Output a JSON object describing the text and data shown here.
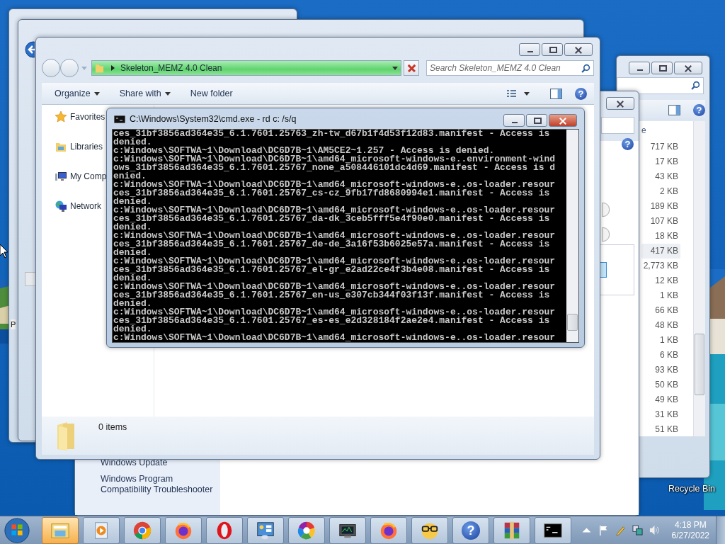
{
  "desktop": {
    "recycle_bin": "Recycle Bin"
  },
  "back_window": {
    "button_label": "P"
  },
  "control_panel_window": {
    "help_glyph": "?",
    "links": [
      "Windows Update",
      "Windows Program Compatibility Troubleshooter"
    ]
  },
  "size_window": {
    "help_glyph": "?",
    "column_header": "e",
    "rows": [
      {
        "size": "717 KB",
        "selected": false
      },
      {
        "size": "17 KB",
        "selected": false
      },
      {
        "size": "43 KB",
        "selected": false
      },
      {
        "size": "2 KB",
        "selected": false
      },
      {
        "size": "189 KB",
        "selected": false
      },
      {
        "size": "107 KB",
        "selected": false
      },
      {
        "size": "18 KB",
        "selected": false
      },
      {
        "size": "417 KB",
        "selected": true
      },
      {
        "size": "2,773 KB",
        "selected": false
      },
      {
        "size": "12 KB",
        "selected": false
      },
      {
        "size": "1 KB",
        "selected": false
      },
      {
        "size": "66 KB",
        "selected": false
      },
      {
        "size": "48 KB",
        "selected": false
      },
      {
        "size": "1 KB",
        "selected": false
      },
      {
        "size": "6 KB",
        "selected": false
      },
      {
        "size": "93 KB",
        "selected": false
      },
      {
        "size": "50 KB",
        "selected": false
      },
      {
        "size": "49 KB",
        "selected": false
      },
      {
        "size": "31 KB",
        "selected": false
      },
      {
        "size": "51 KB",
        "selected": false
      }
    ]
  },
  "explorer": {
    "address": {
      "path": "Skeleton_MEMZ 4.0 Clean",
      "level": 1
    },
    "search": {
      "placeholder": "Search Skeleton_MEMZ 4.0 Clean"
    },
    "help_glyph": "?",
    "toolbar": [
      {
        "label": "Organize",
        "dropdown": true
      },
      {
        "label": "Share with",
        "dropdown": true
      },
      {
        "label": "New folder",
        "dropdown": false
      }
    ],
    "nav": [
      {
        "label": "Favorites",
        "kind": "favorites"
      },
      {
        "label": "Libraries",
        "kind": "libraries"
      },
      {
        "label": "My Comp",
        "kind": "computer"
      },
      {
        "label": "Network",
        "kind": "network"
      }
    ],
    "status": "0 items"
  },
  "console": {
    "title": "C:\\Windows\\System32\\cmd.exe - rd  c: /s/q",
    "lines": [
      "ces_31bf3856ad364e35_6.1.7601.25763_zh-tw_d67b1f4d53f12d83.manifest - Access is",
      "denied.",
      "c:Windows\\SOFTWA~1\\Download\\DC6D7B~1\\AM5CE2~1.257 - Access is denied.",
      "c:Windows\\SOFTWA~1\\Download\\DC6D7B~1\\amd64_microsoft-windows-e..environment-wind",
      "ows_31bf3856ad364e35_6.1.7601.25767_none_a508446101dc4d69.manifest - Access is d",
      "enied.",
      "c:Windows\\SOFTWA~1\\Download\\DC6D7B~1\\amd64_microsoft-windows-e..os-loader.resour",
      "ces_31bf3856ad364e35_6.1.7601.25767_cs-cz_9fb17fd8680994e1.manifest - Access is",
      "denied.",
      "c:Windows\\SOFTWA~1\\Download\\DC6D7B~1\\amd64_microsoft-windows-e..os-loader.resour",
      "ces_31bf3856ad364e35_6.1.7601.25767_da-dk_3ceb5fff5e4f90e0.manifest - Access is",
      "denied.",
      "c:Windows\\SOFTWA~1\\Download\\DC6D7B~1\\amd64_microsoft-windows-e..os-loader.resour",
      "ces_31bf3856ad364e35_6.1.7601.25767_de-de_3a16f53b6025e57a.manifest - Access is",
      "denied.",
      "c:Windows\\SOFTWA~1\\Download\\DC6D7B~1\\amd64_microsoft-windows-e..os-loader.resour",
      "ces_31bf3856ad364e35_6.1.7601.25767_el-gr_e2ad22ce4f3b4e08.manifest - Access is",
      "denied.",
      "c:Windows\\SOFTWA~1\\Download\\DC6D7B~1\\amd64_microsoft-windows-e..os-loader.resour",
      "ces_31bf3856ad364e35_6.1.7601.25767_en-us_e307cb344f03f13f.manifest - Access is",
      "denied.",
      "c:Windows\\SOFTWA~1\\Download\\DC6D7B~1\\amd64_microsoft-windows-e..os-loader.resour",
      "ces_31bf3856ad364e35_6.1.7601.25767_es-es_e2d328184f2ae2e4.manifest - Access is",
      "denied.",
      "c:Windows\\SOFTWA~1\\Download\\DC6D7B~1\\amd64_microsoft-windows-e..os-loader.resour"
    ]
  },
  "taskbar": {
    "help_glyph": "?",
    "apps": [
      {
        "kind": "explorer",
        "highlighted": true
      },
      {
        "kind": "media",
        "highlighted": false
      },
      {
        "kind": "chrome",
        "highlighted": false
      },
      {
        "kind": "firefox",
        "highlighted": false
      },
      {
        "kind": "opera",
        "highlighted": false
      },
      {
        "kind": "control",
        "highlighted": false
      },
      {
        "kind": "pinwheel",
        "highlighted": false
      },
      {
        "kind": "monitor",
        "highlighted": false
      },
      {
        "kind": "firefox",
        "highlighted": false
      },
      {
        "kind": "glasses",
        "highlighted": false
      },
      {
        "kind": "help",
        "highlighted": false
      },
      {
        "kind": "archive",
        "highlighted": false
      },
      {
        "kind": "console",
        "highlighted": false
      }
    ],
    "clock": {
      "time": "4:18 PM",
      "date": "6/27/2022"
    }
  }
}
